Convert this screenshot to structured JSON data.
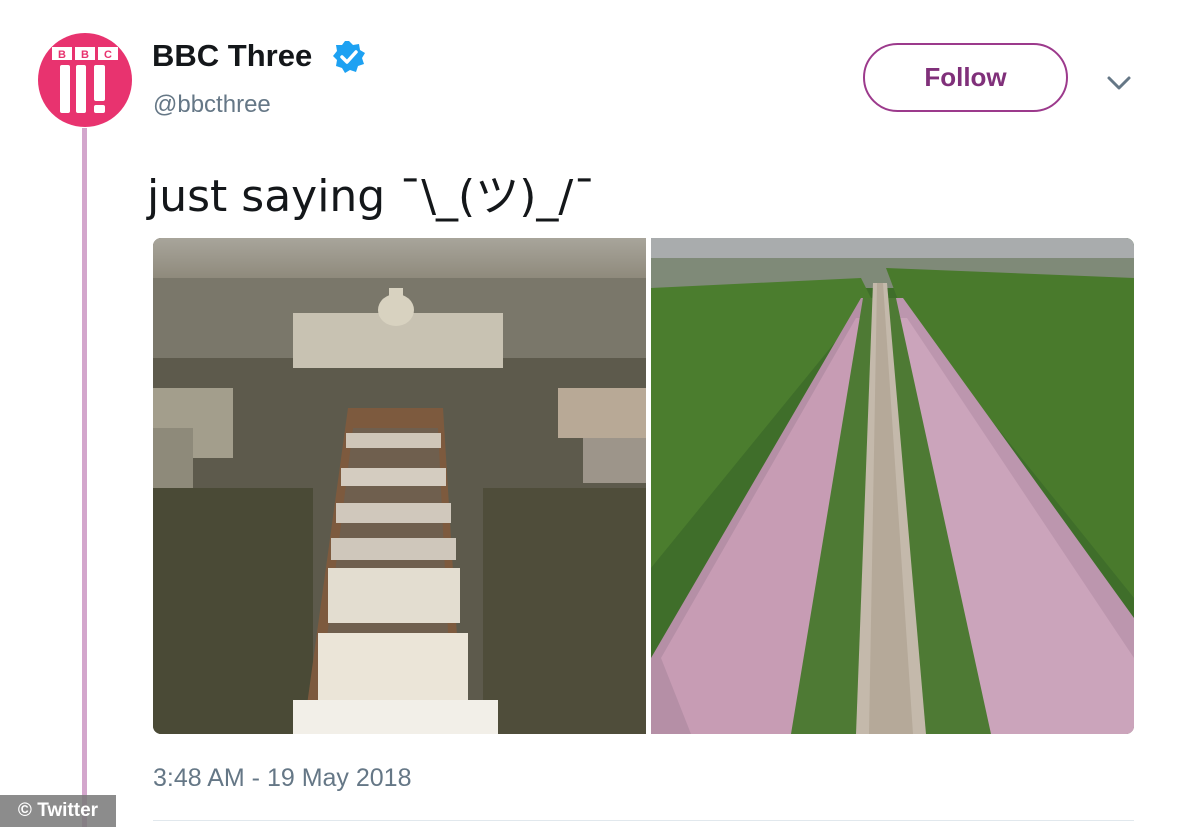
{
  "author": {
    "display_name": "BBC Three",
    "handle": "@bbcthree",
    "avatar_icon": "bbc-three-logo",
    "verified_icon": "verified-badge-icon",
    "avatar_color": "#e8336f"
  },
  "follow_button": {
    "label": "Follow",
    "color": "#9c3a8c"
  },
  "menu": {
    "icon": "chevron-down-icon"
  },
  "tweet": {
    "text": "just saying ¯\\_(ツ)_/¯"
  },
  "media": {
    "images": [
      {
        "icon": "aerial-crowd-washington-photo"
      },
      {
        "icon": "aerial-crowd-long-walk-photo"
      }
    ]
  },
  "timestamp": "3:48 AM - 19 May 2018",
  "watermark": "© Twitter"
}
